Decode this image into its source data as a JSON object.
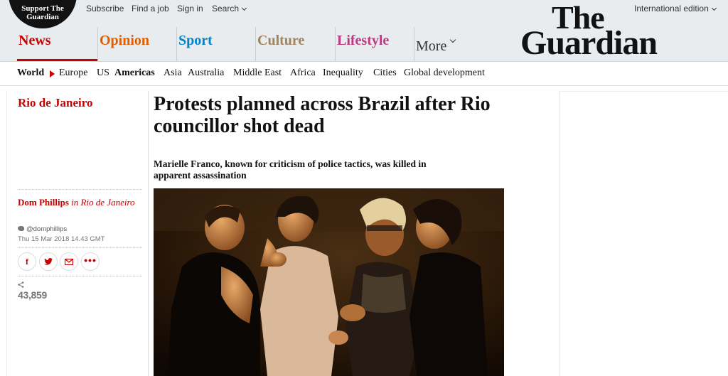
{
  "header": {
    "support_label": "Support The Guardian",
    "utility": {
      "subscribe": "Subscribe",
      "find_job": "Find a job",
      "sign_in": "Sign in",
      "search": "Search"
    },
    "edition": "International edition",
    "logo_line1": "The",
    "logo_line2": "Guardian"
  },
  "pillars": [
    {
      "label": "News",
      "color": "#c70000"
    },
    {
      "label": "Opinion",
      "color": "#e05e00"
    },
    {
      "label": "Sport",
      "color": "#0084c6"
    },
    {
      "label": "Culture",
      "color": "#a1845c"
    },
    {
      "label": "Lifestyle",
      "color": "#bb3b80"
    },
    {
      "label": "More",
      "color": "#121212"
    }
  ],
  "subnav": {
    "world": "World",
    "items": [
      "Europe",
      "US",
      "Americas",
      "Asia",
      "Australia",
      "Middle East",
      "Africa",
      "Inequality",
      "Cities",
      "Global development"
    ]
  },
  "article": {
    "section": "Rio de Janeiro",
    "headline": "Protests planned across Brazil after Rio councillor shot dead",
    "standfirst": "Marielle Franco, known for criticism of police tactics, was killed in apparent assassination",
    "author": "Dom Phillips",
    "location": "in Rio de Janeiro",
    "twitter": "@domphillips",
    "dateline": "Thu 15 Mar 2018 14.43 GMT",
    "share_count": "43,859"
  },
  "share_buttons": {
    "facebook": "f",
    "more": "•••"
  }
}
